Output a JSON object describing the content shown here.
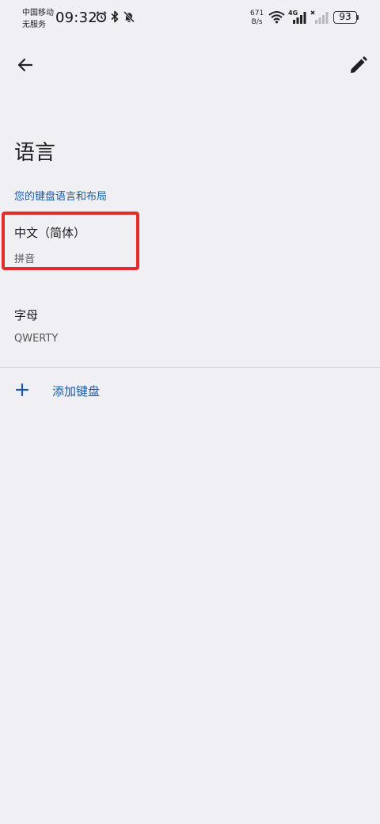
{
  "status_bar": {
    "carrier_line1": "中国移动",
    "carrier_line2": "无服务",
    "time": "09:32",
    "speed_value": "671",
    "speed_unit": "B/s",
    "network": "4G",
    "battery": "93"
  },
  "app_bar": {
    "back_icon": "arrow-left-icon",
    "edit_icon": "pencil-icon"
  },
  "page": {
    "title": "语言",
    "section_label": "您的键盘语言和布局"
  },
  "keyboards": [
    {
      "title": "中文（简体）",
      "subtitle": "拼音"
    },
    {
      "title": "字母",
      "subtitle": "QWERTY"
    }
  ],
  "add_keyboard": {
    "label": "添加键盘",
    "icon": "plus-icon"
  },
  "colors": {
    "background": "#f0eff3",
    "accent": "#1a5aa6",
    "highlight": "#e42b2b"
  }
}
